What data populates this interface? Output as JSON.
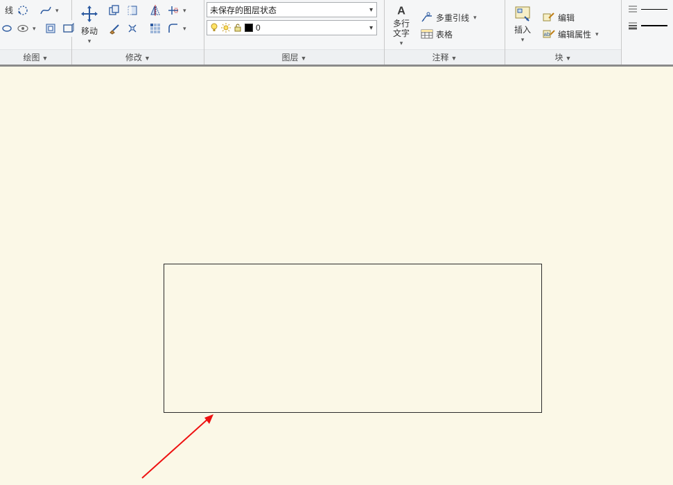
{
  "ribbon": {
    "panels": {
      "draw": {
        "title": "绘图"
      },
      "modify": {
        "title": "修改",
        "move": "移动"
      },
      "layer": {
        "title": "图层",
        "state_combo": "未保存的图层状态",
        "current_layer": "0"
      },
      "annot": {
        "title": "注释",
        "mtext": "多行\n文字",
        "mleader": "多重引线",
        "table": "表格"
      },
      "block": {
        "title": "块",
        "insert": "插入",
        "edit": "编辑",
        "attr_edit": "编辑属性"
      }
    }
  },
  "icons": {
    "line_partial": "线"
  }
}
